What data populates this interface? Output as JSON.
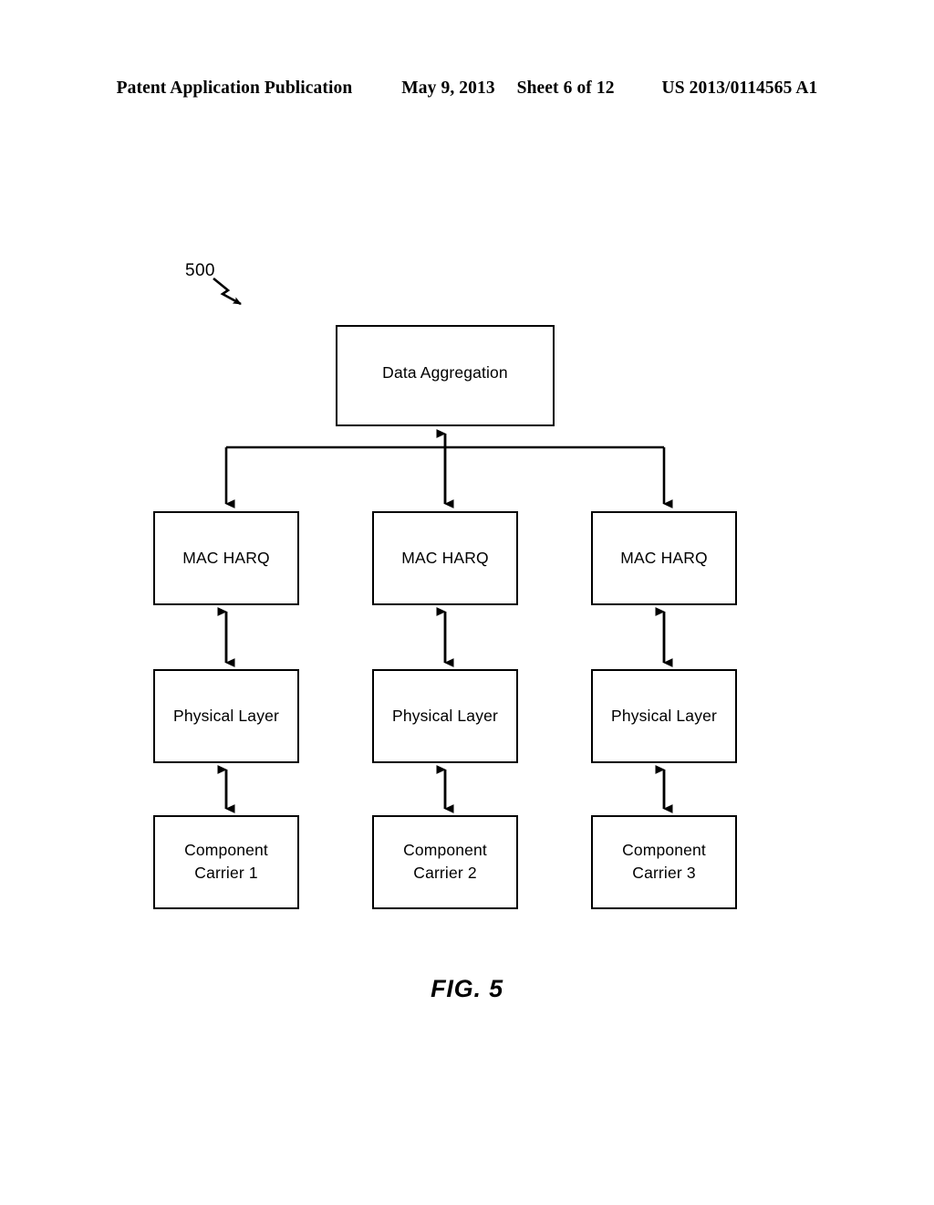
{
  "header": {
    "publication": "Patent Application Publication",
    "date": "May 9, 2013",
    "sheet": "Sheet 6 of 12",
    "patent_number": "US 2013/0114565 A1"
  },
  "figure": {
    "reference_numeral": "500",
    "caption": "FIG. 5",
    "line_color": "#000000",
    "fill_color": "#ffffff"
  },
  "diagram": {
    "top_node": {
      "label": "Data Aggregation"
    },
    "columns": [
      {
        "mac": "MAC HARQ",
        "phy": "Physical Layer",
        "carrier": "Component\nCarrier 1"
      },
      {
        "mac": "MAC HARQ",
        "phy": "Physical Layer",
        "carrier": "Component\nCarrier 2"
      },
      {
        "mac": "MAC HARQ",
        "phy": "Physical Layer",
        "carrier": "Component\nCarrier 3"
      }
    ]
  }
}
